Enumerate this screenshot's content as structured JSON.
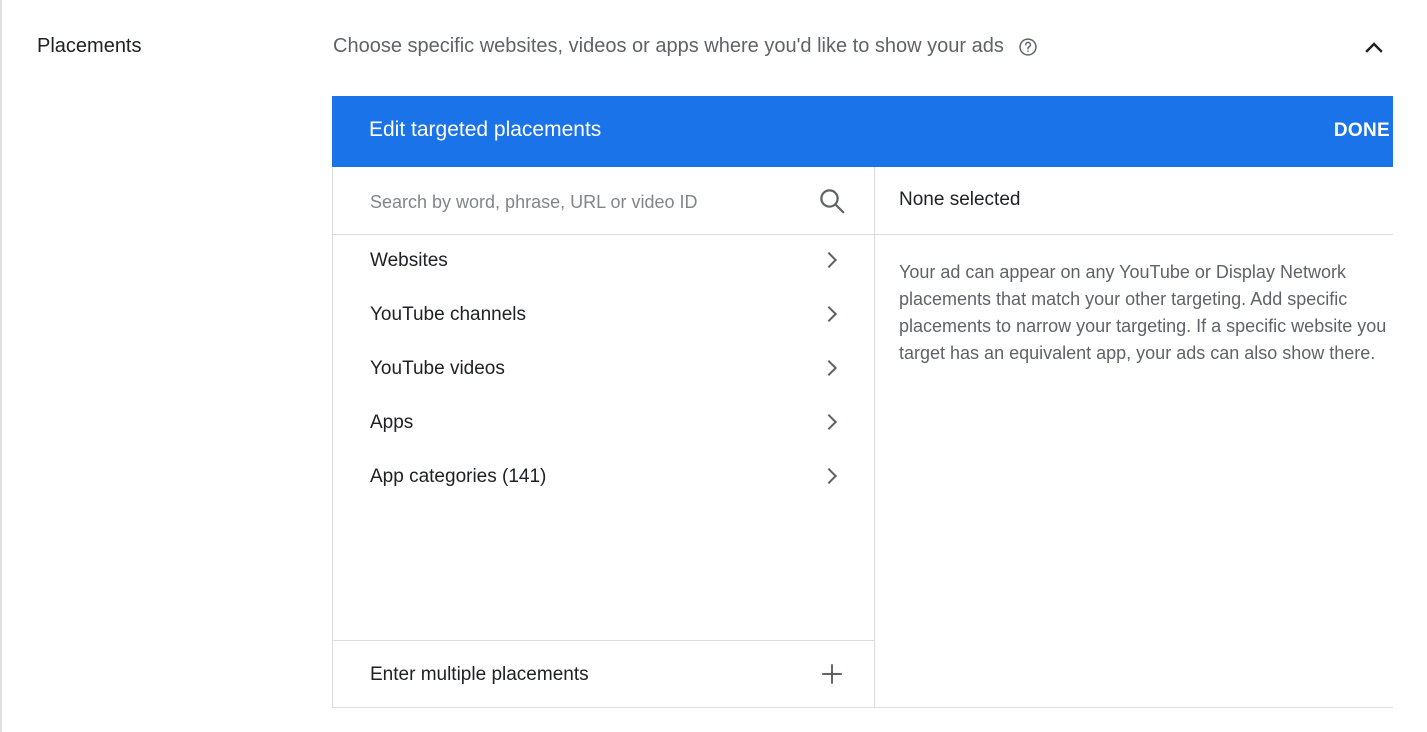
{
  "section": {
    "label": "Placements",
    "description": "Choose specific websites, videos or apps where you'd like to show your ads",
    "help_icon": "help-circle-icon",
    "collapse_icon": "chevron-up-icon"
  },
  "panel": {
    "title": "Edit targeted placements",
    "done_label": "DONE",
    "header_color": "#1a73e8",
    "search": {
      "placeholder": "Search by word, phrase, URL or video ID",
      "value": "",
      "icon": "search-icon"
    },
    "categories": [
      {
        "label": "Websites",
        "icon": "chevron-right-icon"
      },
      {
        "label": "YouTube channels",
        "icon": "chevron-right-icon"
      },
      {
        "label": "YouTube videos",
        "icon": "chevron-right-icon"
      },
      {
        "label": "Apps",
        "icon": "chevron-right-icon"
      },
      {
        "label": "App categories (141)",
        "icon": "chevron-right-icon"
      }
    ],
    "multi_entry": {
      "label": "Enter multiple placements",
      "icon": "plus-icon"
    },
    "selection": {
      "status": "None selected",
      "info": "Your ad can appear on any YouTube or Display Network placements that match your other targeting. Add specific placements to narrow your targeting. If a specific website you target has an equivalent app, your ads can also show there."
    }
  }
}
